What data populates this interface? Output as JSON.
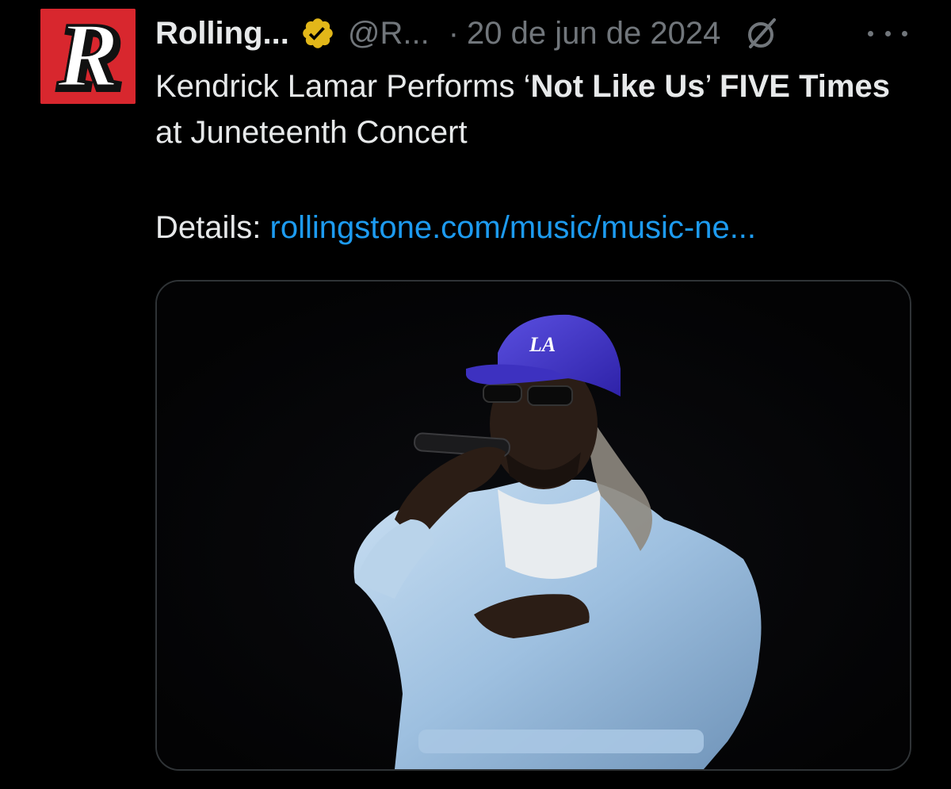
{
  "tweet": {
    "avatar_letter": "R",
    "avatar_icon": "rolling-stone-logo",
    "display_name": "Rolling...",
    "verified_icon": "verified-badge-icon",
    "handle": "@R...",
    "separator": "·",
    "date": "20 de jun de 2024",
    "grok_icon": "grok-icon",
    "more_icon": "more-options-icon",
    "text": {
      "part1": "Kendrick Lamar Performs ‘",
      "bold1": "Not Like Us",
      "part2": "’ ",
      "bold2": "FIVE Times",
      "part3": " at Juneteenth Concert"
    },
    "details_label": "Details: ",
    "link_text": "rollingstone.com/music/music-ne...",
    "media": {
      "subject": "performer-photo",
      "cap_text": "LA"
    }
  },
  "colors": {
    "background": "#000000",
    "text": "#e7e9ea",
    "muted": "#71767b",
    "link": "#1d9bf0",
    "avatar_bg": "#d8272e",
    "verified_gold": "#e2b719"
  }
}
